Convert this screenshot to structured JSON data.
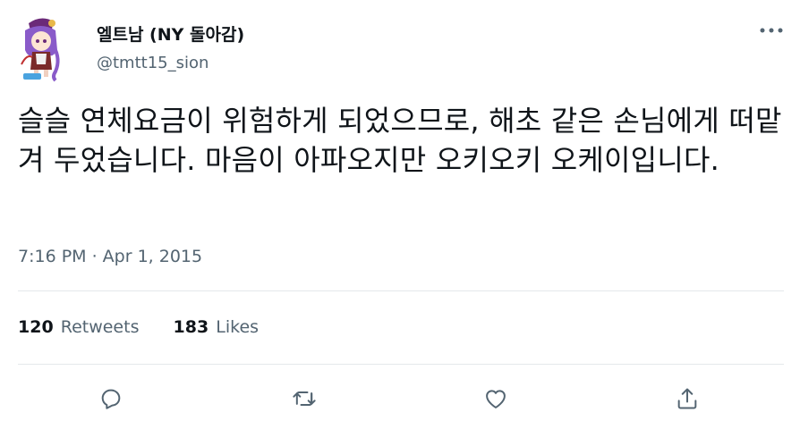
{
  "author": {
    "display_name": "엘트남 (NY 돌아감)",
    "handle": "@tmtt15_sion",
    "avatar": "anime-character-avatar"
  },
  "tweet": {
    "text": "슬슬 연체요금이 위험하게 되었으므로, 해초 같은 손님에게 떠맡겨 두었습니다. 마음이 아파오지만 오키오키 오케이입니다.",
    "timestamp": "7:16 PM · Apr 1, 2015"
  },
  "stats": {
    "retweets_count": "120",
    "retweets_label": "Retweets",
    "likes_count": "183",
    "likes_label": "Likes"
  },
  "icons": {
    "more": "more-icon",
    "reply": "reply-icon",
    "retweet": "retweet-icon",
    "like": "heart-icon",
    "share": "share-icon"
  },
  "colors": {
    "text": "#0f1419",
    "secondary": "#536471",
    "divider": "#e4e8eb",
    "icon": "#536471"
  }
}
